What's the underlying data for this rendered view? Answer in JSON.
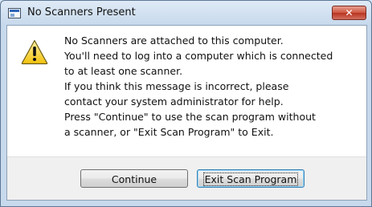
{
  "window": {
    "title": "No Scanners Present",
    "close_glyph": "✕"
  },
  "message": {
    "lines": [
      "No Scanners are attached to this computer.",
      "You'll need to log into a computer which is connected",
      "to at least one scanner.",
      "If you think this message is incorrect, please",
      "contact your system administrator for help.",
      "Press \"Continue\" to use the scan program without",
      "a scanner, or \"Exit Scan Program\" to Exit."
    ]
  },
  "buttons": {
    "continue_label": "Continue",
    "exit_label": "Exit Scan Program"
  },
  "icons": {
    "app": "application-window-icon",
    "warning": "warning-icon",
    "close": "close-icon"
  },
  "colors": {
    "warning_fill": "#f7d51d",
    "warning_stroke": "#6b5a12",
    "close_button": "#c74a35"
  }
}
